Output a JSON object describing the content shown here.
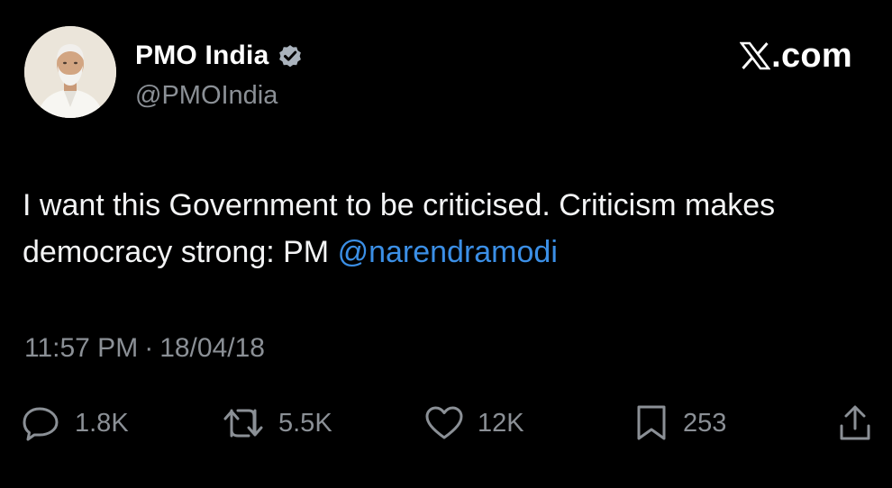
{
  "author": {
    "display_name": "PMO India",
    "handle": "@PMOIndia",
    "verified_icon": "verified-badge-icon",
    "avatar_icon": "avatar-photo"
  },
  "brand": {
    "logo_icon": "x-logo-icon",
    "text": ".com"
  },
  "tweet": {
    "text_before": "I want this Government to be criticised. Criticism makes democracy strong: PM ",
    "mention": "@narendramodi"
  },
  "meta": {
    "time": "11:57 PM",
    "separator": "·",
    "date": "18/04/18"
  },
  "actions": {
    "reply": {
      "icon": "reply-icon",
      "count": "1.8K"
    },
    "retweet": {
      "icon": "retweet-icon",
      "count": "5.5K"
    },
    "like": {
      "icon": "heart-icon",
      "count": "12K"
    },
    "bookmark": {
      "icon": "bookmark-icon",
      "count": "253"
    },
    "share": {
      "icon": "share-icon"
    }
  },
  "colors": {
    "background": "#000000",
    "text": "#e7e9ea",
    "muted": "#8b9096",
    "mention": "#3b8fe6",
    "verified_badge": "#aab3bd"
  }
}
